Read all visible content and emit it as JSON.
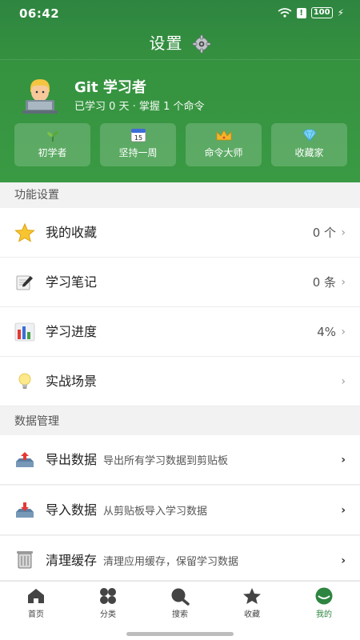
{
  "status_bar": {
    "time": "06:42",
    "battery": "100"
  },
  "header": {
    "title": "设置"
  },
  "profile": {
    "name": "Git 学习者",
    "summary": "已学习 0 天 · 掌握 1 个命令"
  },
  "badges": [
    {
      "label": "初学者",
      "icon": "sprout-icon"
    },
    {
      "label": "坚持一周",
      "icon": "calendar-icon",
      "icon_text": "15"
    },
    {
      "label": "命令大师",
      "icon": "crown-icon"
    },
    {
      "label": "收藏家",
      "icon": "gem-icon"
    }
  ],
  "sections": {
    "features": "功能设置",
    "data": "数据管理"
  },
  "feature_items": [
    {
      "label": "我的收藏",
      "value": "0 个",
      "icon": "star-icon"
    },
    {
      "label": "学习笔记",
      "value": "0 条",
      "icon": "note-icon"
    },
    {
      "label": "学习进度",
      "value": "4%",
      "icon": "bar-chart-icon"
    },
    {
      "label": "实战场景",
      "value": "",
      "icon": "lightbulb-icon"
    }
  ],
  "data_items": [
    {
      "label": "导出数据",
      "desc": "导出所有学习数据到剪贴板",
      "icon": "export-tray-icon"
    },
    {
      "label": "导入数据",
      "desc": "从剪贴板导入学习数据",
      "icon": "import-tray-icon"
    },
    {
      "label": "清理缓存",
      "desc": "清理应用缓存，保留学习数据",
      "icon": "trash-icon"
    }
  ],
  "tabs": [
    {
      "label": "首页",
      "icon": "home-icon"
    },
    {
      "label": "分类",
      "icon": "category-icon"
    },
    {
      "label": "搜索",
      "icon": "search-icon"
    },
    {
      "label": "收藏",
      "icon": "star-icon"
    },
    {
      "label": "我的",
      "icon": "profile-icon",
      "active": true
    }
  ],
  "colors": {
    "primary": "#2e8540",
    "background": "#f2f2f2"
  }
}
